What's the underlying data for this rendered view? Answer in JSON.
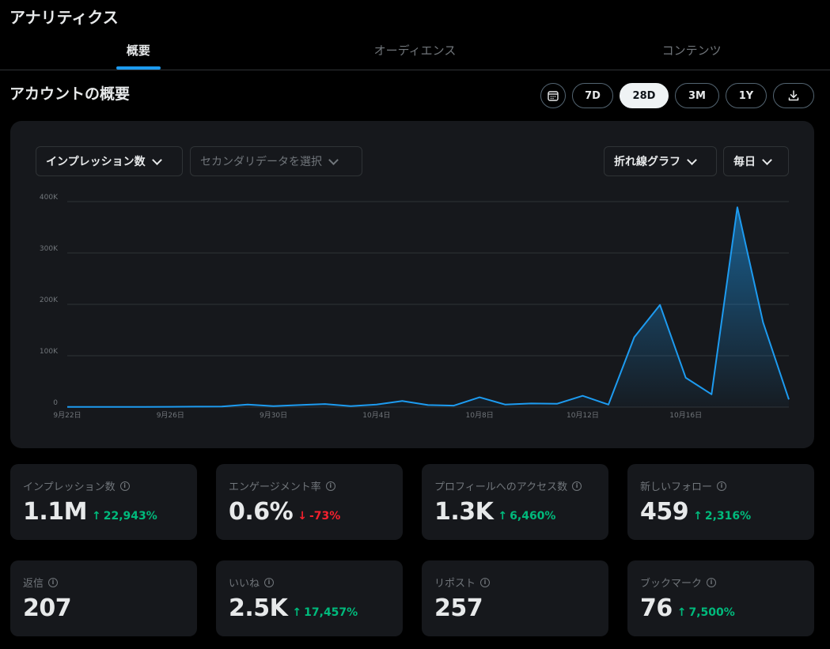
{
  "app": {
    "title": "アナリティクス"
  },
  "tabs": [
    {
      "label": "概要",
      "active": true
    },
    {
      "label": "オーディエンス",
      "active": false
    },
    {
      "label": "コンテンツ",
      "active": false
    }
  ],
  "overview": {
    "title": "アカウントの概要"
  },
  "ranges": [
    {
      "label": "7D",
      "active": false
    },
    {
      "label": "28D",
      "active": true
    },
    {
      "label": "3M",
      "active": false
    },
    {
      "label": "1Y",
      "active": false
    }
  ],
  "controls": {
    "primary_metric": "インプレッション数",
    "secondary_metric_placeholder": "セカンダリデータを選択",
    "chart_type": "折れ線グラフ",
    "interval": "毎日",
    "icons": {
      "calendar": "calendar-icon",
      "download": "download-icon",
      "chevron": "chevron-down-icon",
      "info": "info-icon",
      "up": "arrow-up-icon",
      "down": "arrow-down-icon"
    }
  },
  "colors": {
    "accent": "#1d9bf0",
    "positive": "#00ba7c",
    "negative": "#f4212e"
  },
  "chart_data": {
    "type": "area",
    "x_ticks": [
      "9月22日",
      "9月26日",
      "9月30日",
      "10月4日",
      "10月8日",
      "10月12日",
      "10月16日"
    ],
    "y_ticks": [
      "0",
      "100K",
      "200K",
      "300K",
      "400K"
    ],
    "ylim": [
      0,
      400000
    ],
    "grid": true,
    "series": [
      {
        "values": [
          500,
          500,
          500,
          500,
          600,
          1000,
          1200,
          5000,
          2000,
          4000,
          6000,
          2000,
          5000,
          12000,
          4000,
          3000,
          19000,
          5000,
          7000,
          6500,
          22000,
          5000,
          136000,
          199000,
          57000,
          25000,
          389000,
          165000,
          15000
        ]
      }
    ]
  },
  "stats": [
    {
      "label": "インプレッション数",
      "value": "1.1M",
      "change": "22,943%",
      "direction": "up"
    },
    {
      "label": "エンゲージメント率",
      "value": "0.6%",
      "change": "-73%",
      "direction": "down"
    },
    {
      "label": "プロフィールへのアクセス数",
      "value": "1.3K",
      "change": "6,460%",
      "direction": "up"
    },
    {
      "label": "新しいフォロー",
      "value": "459",
      "change": "2,316%",
      "direction": "up"
    },
    {
      "label": "返信",
      "value": "207",
      "change": "",
      "direction": ""
    },
    {
      "label": "いいね",
      "value": "2.5K",
      "change": "17,457%",
      "direction": "up"
    },
    {
      "label": "リポスト",
      "value": "257",
      "change": "",
      "direction": ""
    },
    {
      "label": "ブックマーク",
      "value": "76",
      "change": "7,500%",
      "direction": "up"
    }
  ]
}
